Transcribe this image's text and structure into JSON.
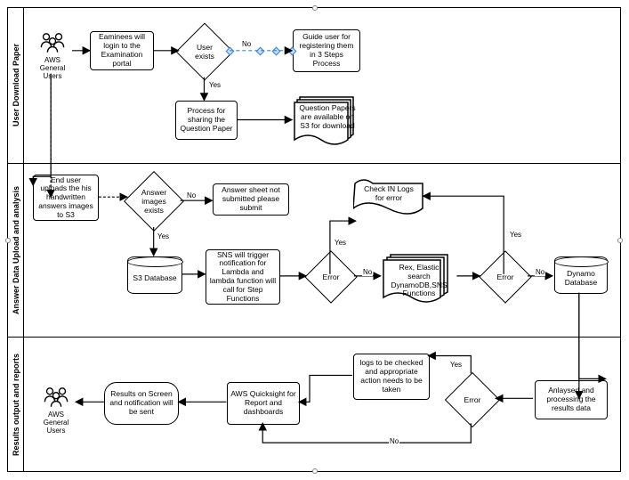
{
  "lanes": {
    "lane1": "User Download Paper",
    "lane2": "Answer Data Upload and analysis",
    "lane3": "Results output and reports"
  },
  "actors": {
    "users_top": "AWS General Users",
    "users_bottom": "AWS General Users"
  },
  "nodes": {
    "login": "Eaminees will login to the Examination portal",
    "user_exists": "User exists",
    "guide": "Guide user for registering them in 3 Steps Process",
    "process_share": "Process for sharing the Question Paper",
    "papers_s3": "Question Papers are available on S3 for download",
    "upload": "End user uploads the his handwritten answers images to S3",
    "answer_exists": "Answer images exists",
    "not_submitted": "Answer sheet not submitted please submit",
    "s3_db": "S3 Database",
    "sns_lambda": "SNS will trigger notification for Lambda and lambda function will call for Step Functions",
    "error1": "Error",
    "check_logs": "Check IN Logs for error",
    "rex_stack": "Rex, Elastic search DynamoDB,SNS Functions",
    "error2": "Error",
    "dynamo": "Dynamo Database",
    "analysed": "Anlaysed and processing the results data",
    "error3": "Error",
    "logs_action": "logs to be checked and appropriate action needs to be taken",
    "quicksight": "AWS Quicksight for Report and dashboards",
    "results_screen": "Results on Screen and notification will be sent"
  },
  "edges": {
    "no": "No",
    "yes": "Yes"
  }
}
